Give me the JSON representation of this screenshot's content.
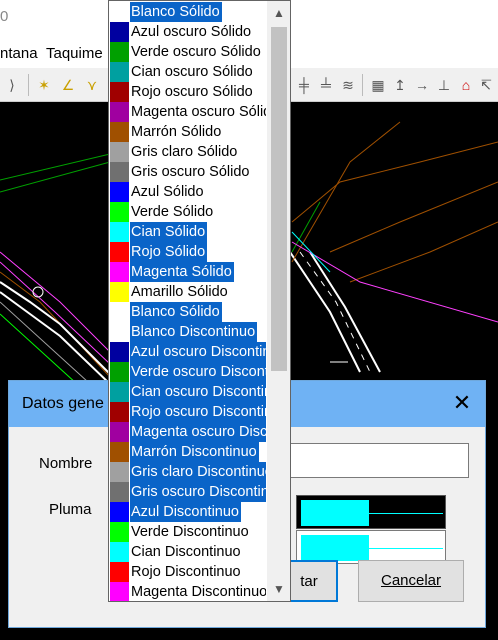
{
  "window": {
    "title_fragment": "0"
  },
  "menu": {
    "items": [
      "ntana",
      "Taquime"
    ]
  },
  "dialog": {
    "title": "Datos gene",
    "name_label": "Nombre",
    "name_value": "",
    "pen_label": "Pluma",
    "accept_label": "tar",
    "cancel_label": "Cancelar"
  },
  "pen": {
    "selected_color": "#00ffff"
  },
  "dropdown": {
    "items": [
      {
        "label": "Blanco Sólido",
        "color": "#ffffff",
        "selected": true
      },
      {
        "label": "Azul oscuro Sólido",
        "color": "#0000a0",
        "selected": false
      },
      {
        "label": "Verde oscuro Sólido",
        "color": "#00a000",
        "selected": false
      },
      {
        "label": "Cian oscuro Sólido",
        "color": "#00a0a0",
        "selected": false
      },
      {
        "label": "Rojo oscuro Sólido",
        "color": "#a00000",
        "selected": false
      },
      {
        "label": "Magenta oscuro Sólido",
        "color": "#a000a0",
        "selected": false
      },
      {
        "label": "Marrón Sólido",
        "color": "#a05000",
        "selected": false
      },
      {
        "label": "Gris claro Sólido",
        "color": "#a0a0a0",
        "selected": false
      },
      {
        "label": "Gris oscuro Sólido",
        "color": "#707070",
        "selected": false
      },
      {
        "label": "Azul Sólido",
        "color": "#0000ff",
        "selected": false
      },
      {
        "label": "Verde Sólido",
        "color": "#00ff00",
        "selected": false
      },
      {
        "label": "Cian Sólido",
        "color": "#00ffff",
        "selected": true
      },
      {
        "label": "Rojo Sólido",
        "color": "#ff0000",
        "selected": true
      },
      {
        "label": "Magenta Sólido",
        "color": "#ff00ff",
        "selected": true
      },
      {
        "label": "Amarillo Sólido",
        "color": "#ffff00",
        "selected": false
      },
      {
        "label": "Blanco Sólido",
        "color": "#ffffff",
        "selected": true
      },
      {
        "label": "Blanco Discontinuo",
        "color": "#ffffff",
        "selected": true
      },
      {
        "label": "Azul oscuro Discontinuo",
        "color": "#0000a0",
        "selected": true
      },
      {
        "label": "Verde oscuro Discontinuo",
        "color": "#00a000",
        "selected": true
      },
      {
        "label": "Cian oscuro Discontinuo",
        "color": "#00a0a0",
        "selected": true
      },
      {
        "label": "Rojo oscuro Discontinuo",
        "color": "#a00000",
        "selected": true
      },
      {
        "label": "Magenta oscuro Discontinuo",
        "color": "#a000a0",
        "selected": true
      },
      {
        "label": "Marrón Discontinuo",
        "color": "#a05000",
        "selected": true
      },
      {
        "label": "Gris claro Discontinuo",
        "color": "#a0a0a0",
        "selected": true
      },
      {
        "label": "Gris oscuro Discontinuo",
        "color": "#707070",
        "selected": true
      },
      {
        "label": "Azul Discontinuo",
        "color": "#0000ff",
        "selected": true
      },
      {
        "label": "Verde Discontinuo",
        "color": "#00ff00",
        "selected": false
      },
      {
        "label": "Cian Discontinuo",
        "color": "#00ffff",
        "selected": false
      },
      {
        "label": "Rojo Discontinuo",
        "color": "#ff0000",
        "selected": false
      },
      {
        "label": "Magenta Discontinuo",
        "color": "#ff00ff",
        "selected": false
      }
    ]
  },
  "colors": {
    "selection": "#0a64c8",
    "dialog_title_bar": "#6fb2f4"
  }
}
